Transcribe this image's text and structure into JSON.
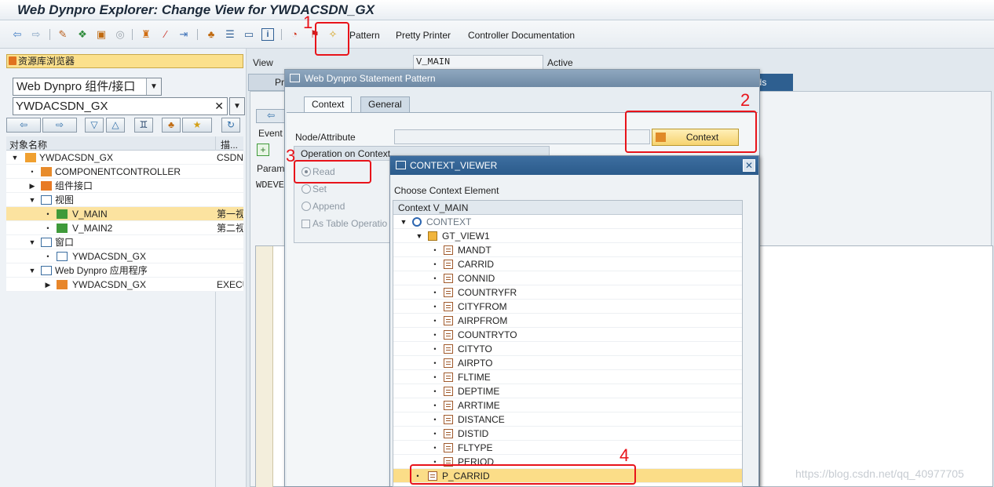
{
  "window": {
    "title": "Web Dynpro Explorer: Change View for YWDACSDN_GX"
  },
  "toolbar": {
    "icons": [
      "back-arrow-icon",
      "forward-arrow-icon",
      "glasses-icon",
      "objects-icon",
      "clipboard-icon",
      "circle-icon",
      "hierarchy-icon",
      "magic-wand-icon",
      "transport-icon",
      "tree-icon",
      "list-icon",
      "window-icon",
      "info-icon",
      "pie-icon",
      "wizard-icon",
      "wand-sparkle-icon"
    ],
    "pattern": "Pattern",
    "pretty_printer": "Pretty Printer",
    "controller_documentation": "Controller Documentation"
  },
  "left": {
    "repo_browser": "资源库浏览器",
    "category_select": "Web Dynpro 组件/接口",
    "object_name": "YWDACSDN_GX",
    "clear_symbol": "✕",
    "columns": {
      "name": "对象名称",
      "desc": "描..."
    },
    "tree": [
      {
        "label": "YWDACSDN_GX",
        "desc": "CSDN"
      },
      {
        "label": "COMPONENTCONTROLLER",
        "desc": ""
      },
      {
        "label": "组件接口",
        "desc": ""
      },
      {
        "label": "视图",
        "desc": ""
      },
      {
        "label": "V_MAIN",
        "desc": "第一视"
      },
      {
        "label": "V_MAIN2",
        "desc": "第二视"
      },
      {
        "label": "窗口",
        "desc": ""
      },
      {
        "label": "YWDACSDN_GX",
        "desc": ""
      },
      {
        "label": "Web Dynpro 应用程序",
        "desc": ""
      },
      {
        "label": "YWDACSDN_GX",
        "desc": "EXECU"
      }
    ]
  },
  "main": {
    "view_label": "View",
    "view_value": "V_MAIN",
    "status": "Active",
    "bg_tab_methods_partial": "ods",
    "bg_tab_pr": "Pr",
    "bg_event": "Event",
    "bg_param": "Param",
    "bg_wdeve": "WDEVE"
  },
  "pattern_dialog": {
    "title": "Web Dynpro Statement Pattern",
    "tabs": [
      "Context",
      "General"
    ],
    "node_attribute_label": "Node/Attribute",
    "context_button": "Context",
    "operation_header": "Operation on Context",
    "operations": [
      "Read",
      "Set",
      "Append"
    ],
    "as_table_operation": "As Table Operatio"
  },
  "context_viewer": {
    "title": "CONTEXT_VIEWER",
    "prompt": "Choose Context Element",
    "tree_header": "Context V_MAIN",
    "root": "CONTEXT",
    "node": "GT_VIEW1",
    "attributes": [
      "MANDT",
      "CARRID",
      "CONNID",
      "COUNTRYFR",
      "CITYFROM",
      "AIRPFROM",
      "COUNTRYTO",
      "CITYTO",
      "AIRPTO",
      "FLTIME",
      "DEPTIME",
      "ARRTIME",
      "DISTANCE",
      "DISTID",
      "FLTYPE",
      "PERIOD"
    ],
    "selected": "P_CARRID"
  },
  "annotations": {
    "n1": "1",
    "n2": "2",
    "n3": "3",
    "n4": "4",
    "color": "#e8131a"
  },
  "watermark": "https://blog.csdn.net/qq_40977705"
}
